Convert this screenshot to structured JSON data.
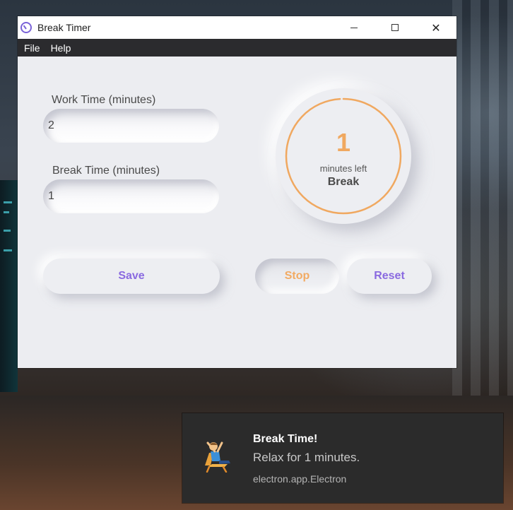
{
  "window": {
    "title": "Break Timer",
    "controls": {
      "minimize": "—",
      "maximize": "☐",
      "close": "✕"
    }
  },
  "menu": {
    "items": [
      "File",
      "Help"
    ]
  },
  "form": {
    "work_label": "Work Time (minutes)",
    "work_value": "2",
    "break_label": "Break Time (minutes)",
    "break_value": "1"
  },
  "timer": {
    "value": "1",
    "caption": "minutes left",
    "mode": "Break",
    "progress_fraction": 0.99
  },
  "buttons": {
    "save": "Save",
    "stop": "Stop",
    "reset": "Reset"
  },
  "notification": {
    "title": "Break Time!",
    "body": "Relax for 1 minutes.",
    "source": "electron.app.Electron",
    "icon": "relaxing-person-icon"
  },
  "colors": {
    "accent_purple": "#8a6ae0",
    "accent_orange": "#f0a860",
    "surface": "#ecedf1",
    "menubar": "#2b2b2e"
  }
}
